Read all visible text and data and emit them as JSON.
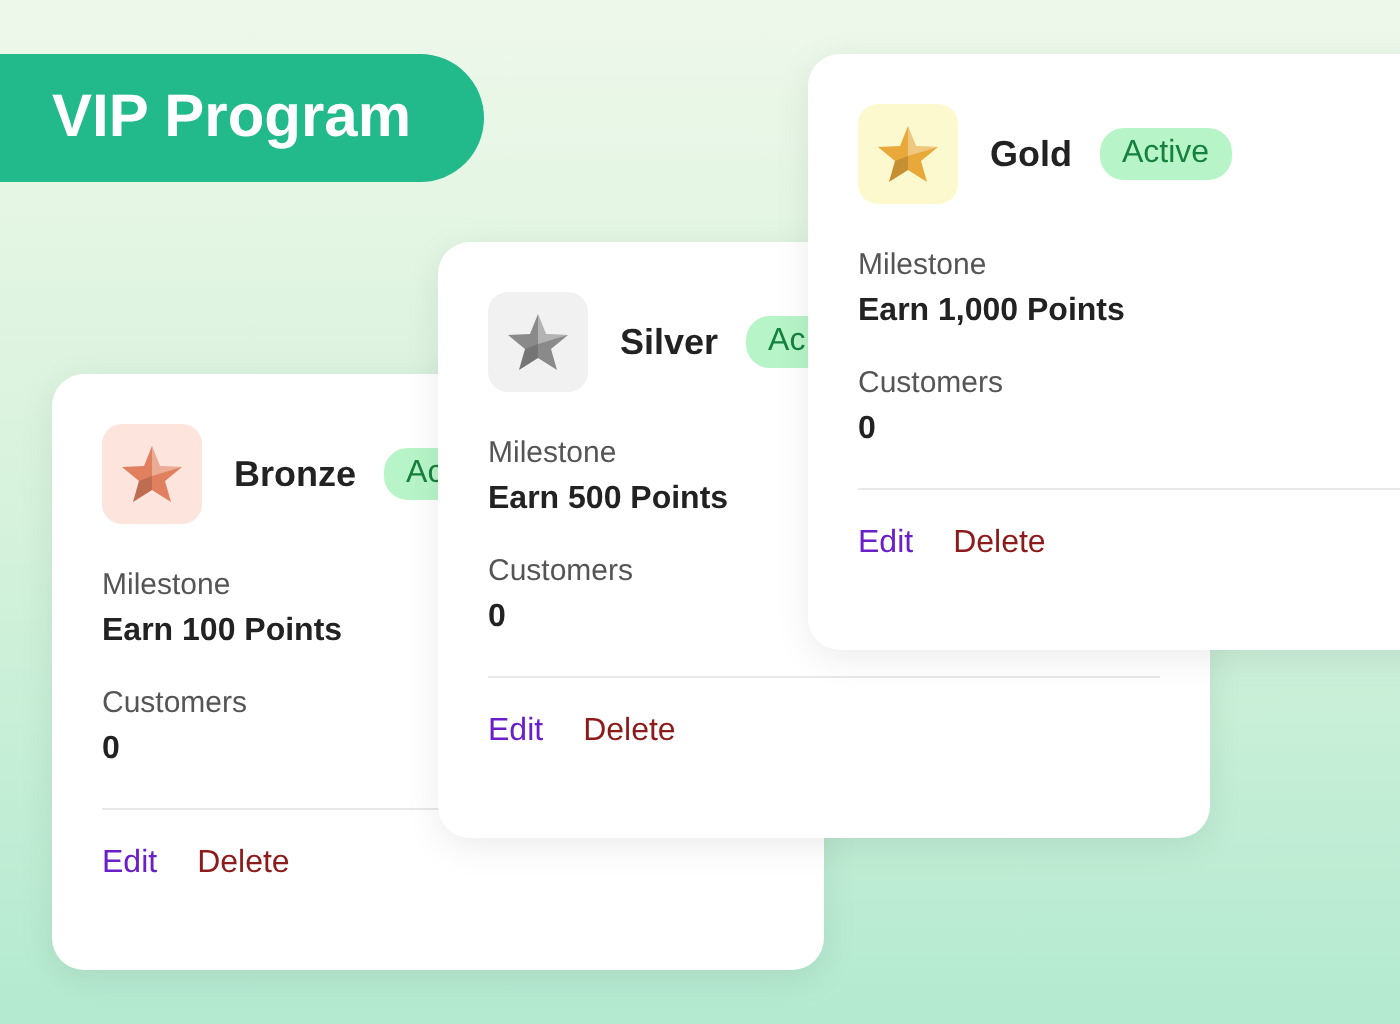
{
  "banner": {
    "title": "VIP Program"
  },
  "tiers": [
    {
      "name": "Bronze",
      "badge": "Ac",
      "color": "#e0805f",
      "milestone_label": "Milestone",
      "milestone": "Earn 100 Points",
      "customers_label": "Customers",
      "customers": "0",
      "actions": [
        "Edit",
        "Delete"
      ]
    },
    {
      "name": "Silver",
      "badge": "Ac",
      "color": "#8a8a8a",
      "milestone_label": "Milestone",
      "milestone": "Earn 500 Points",
      "customers_label": "Customers",
      "customers": "0",
      "actions": [
        "Edit",
        "Delete"
      ]
    },
    {
      "name": "Gold",
      "badge": "Active",
      "color": "#e9a93a",
      "milestone_label": "Milestone",
      "milestone": "Earn 1,000 Points",
      "customers_label": "Customers",
      "customers": "0",
      "actions": [
        "Edit",
        "Delete"
      ]
    }
  ]
}
